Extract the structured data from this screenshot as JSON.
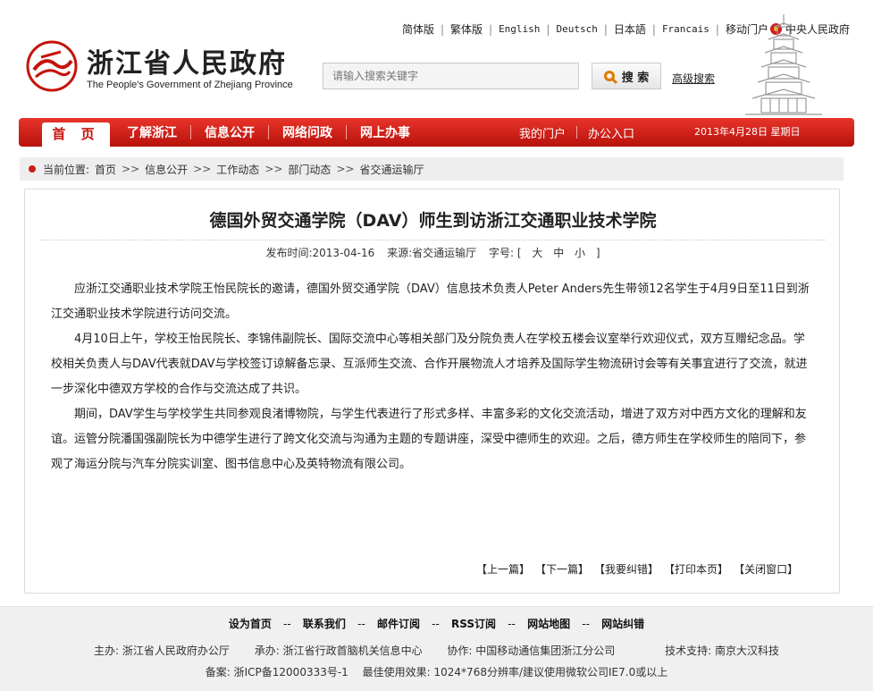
{
  "header": {
    "title_cn": "浙江省人民政府",
    "title_en": "The People's Government of Zhejiang Province",
    "languages": [
      "简体版",
      "繁体版",
      "English",
      "Deutsch",
      "日本語",
      "Francais",
      "移动门户"
    ],
    "central_gov": "中央人民政府",
    "search_placeholder": "请输入搜索关键字",
    "search_button": "搜 索",
    "advanced_search": "高级搜索"
  },
  "nav": {
    "home": "首 页",
    "items": [
      "了解浙江",
      "信息公开",
      "网络问政",
      "网上办事"
    ],
    "right": [
      "我的门户",
      "办公入口"
    ],
    "date": "2013年4月28日 星期日"
  },
  "breadcrumb": {
    "label": "当前位置:",
    "items": [
      "首页",
      "信息公开",
      "工作动态",
      "部门动态",
      "省交通运输厅"
    ],
    "separator": ">>"
  },
  "article": {
    "title": "德国外贸交通学院（DAV）师生到访浙江交通职业技术学院",
    "publish_label": "发布时间:",
    "publish_date": "2013-04-16",
    "source_label": "来源:",
    "source": "省交通运输厅",
    "font_label": "字号:",
    "font_open": "[",
    "font_large": "大",
    "font_medium": "中",
    "font_small": "小",
    "font_close": "]",
    "paragraphs": [
      "应浙江交通职业技术学院王怡民院长的邀请，德国外贸交通学院（DAV）信息技术负责人Peter Anders先生带领12名学生于4月9日至11日到浙江交通职业技术学院进行访问交流。",
      "4月10日上午，学校王怡民院长、李锦伟副院长、国际交流中心等相关部门及分院负责人在学校五楼会议室举行欢迎仪式，双方互赠纪念品。学校相关负责人与DAV代表就DAV与学校签订谅解备忘录、互派师生交流、合作开展物流人才培养及国际学生物流研讨会等有关事宜进行了交流，就进一步深化中德双方学校的合作与交流达成了共识。",
      "期间，DAV学生与学校学生共同参观良渚博物院，与学生代表进行了形式多样、丰富多彩的文化交流活动，增进了双方对中西方文化的理解和友谊。运管分院潘国强副院长为中德学生进行了跨文化交流与沟通为主题的专题讲座，深受中德师生的欢迎。之后，德方师生在学校师生的陪同下，参观了海运分院与汽车分院实训室、图书信息中心及英特物流有限公司。"
    ],
    "actions": [
      "【上一篇】",
      "【下一篇】",
      "【我要纠错】",
      "【打印本页】",
      "【关闭窗口】"
    ]
  },
  "footer": {
    "links": [
      "设为首页",
      "联系我们",
      "邮件订阅",
      "RSS订阅",
      "网站地图",
      "网站纠错"
    ],
    "link_separator": "--",
    "host": "主办: 浙江省人民政府办公厅",
    "operator": "承办: 浙江省行政首脑机关信息中心",
    "partner": "协作: 中国移动通信集团浙江分公司",
    "tech": "技术支持: 南京大汉科技",
    "icp": "备案: 浙ICP备12000333号-1",
    "resolution": "最佳使用效果: 1024*768分辨率/建议使用微软公司IE7.0或以上"
  },
  "colors": {
    "brand_red": "#c4140c",
    "nav_gradient_top": "#e8342a",
    "nav_gradient_bottom": "#b8120c",
    "search_accent": "#e07b00"
  }
}
